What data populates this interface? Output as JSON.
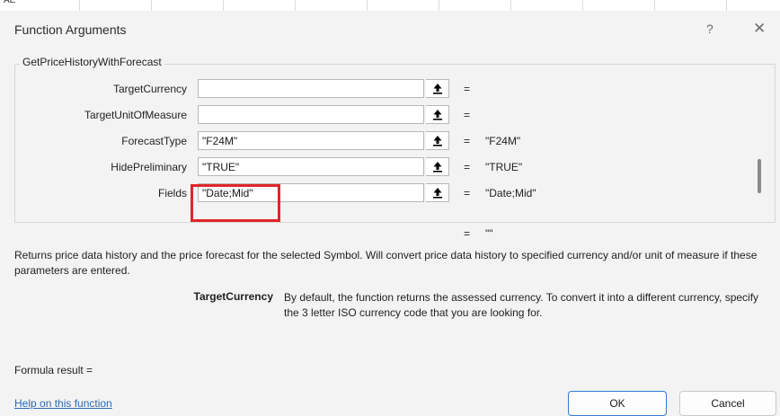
{
  "spreadsheet": {
    "cell_fragment": "AE"
  },
  "dialog": {
    "title": "Function Arguments",
    "help_glyph": "?",
    "close_glyph": "✕",
    "function_name": "GetPriceHistoryWithForecast",
    "arguments": [
      {
        "label": "TargetCurrency",
        "value": "",
        "result": ""
      },
      {
        "label": "TargetUnitOfMeasure",
        "value": "",
        "result": ""
      },
      {
        "label": "ForecastType",
        "value": "\"F24M\"",
        "result": "\"F24M\""
      },
      {
        "label": "HidePreliminary",
        "value": "\"TRUE\"",
        "result": "\"TRUE\""
      },
      {
        "label": "Fields",
        "value": "\"Date;Mid\"",
        "result": "\"Date;Mid\""
      }
    ],
    "equals_sign": "=",
    "function_result": "\"\"",
    "description": "Returns price data history and the price forecast for the selected Symbol. Will convert price data history to specified currency and/or unit of measure if these parameters are entered.",
    "param_help_name": "TargetCurrency",
    "param_help_text": "By default, the function returns the assessed currency. To convert it into a different currency, specify the 3 letter ISO currency code that you are looking for.",
    "formula_result_label": "Formula result =",
    "help_link": "Help on this function",
    "ok_label": "OK",
    "cancel_label": "Cancel"
  },
  "colors": {
    "highlight": "#e0252b",
    "link": "#2a6ab3",
    "ok_border": "#2f7bd0"
  },
  "icons": {
    "reference_button": "collapse-dialog-arrow-icon",
    "help": "question-mark-icon",
    "close": "close-icon"
  }
}
